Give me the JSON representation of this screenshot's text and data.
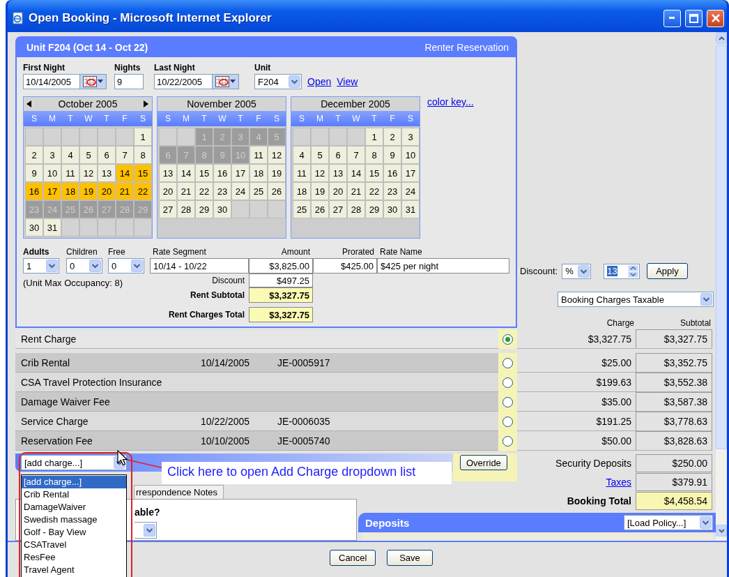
{
  "window": {
    "title": "Open Booking - Microsoft Internet Explorer"
  },
  "unit_panel": {
    "title": "Unit F204 (Oct 14 - Oct 22)",
    "subtitle": "Renter Reservation",
    "first_night": {
      "label": "First Night",
      "value": "10/14/2005"
    },
    "nights": {
      "label": "Nights",
      "value": "9"
    },
    "last_night": {
      "label": "Last Night",
      "value": "10/22/2005"
    },
    "unit": {
      "label": "Unit",
      "value": "F204"
    },
    "links": [
      "Open",
      "View"
    ],
    "color_key": "color key...",
    "calendars": [
      {
        "title": "October 2005",
        "prev_arrow": true,
        "next_arrow": true,
        "weekdays": [
          "S",
          "M",
          "T",
          "W",
          "T",
          "F",
          "S"
        ],
        "weeks": [
          [
            {
              "kind": "empty"
            },
            {
              "kind": "empty"
            },
            {
              "kind": "empty"
            },
            {
              "kind": "empty"
            },
            {
              "kind": "empty"
            },
            {
              "kind": "empty"
            },
            {
              "day": "1",
              "kind": "open"
            }
          ],
          [
            {
              "day": "2",
              "kind": "open"
            },
            {
              "day": "3",
              "kind": "open"
            },
            {
              "day": "4",
              "kind": "open"
            },
            {
              "day": "5",
              "kind": "open"
            },
            {
              "day": "6",
              "kind": "open"
            },
            {
              "day": "7",
              "kind": "open"
            },
            {
              "day": "8",
              "kind": "open"
            }
          ],
          [
            {
              "day": "9",
              "kind": "open"
            },
            {
              "day": "10",
              "kind": "open"
            },
            {
              "day": "11",
              "kind": "open"
            },
            {
              "day": "12",
              "kind": "open"
            },
            {
              "day": "13",
              "kind": "open"
            },
            {
              "day": "14",
              "kind": "booked"
            },
            {
              "day": "15",
              "kind": "booked"
            }
          ],
          [
            {
              "day": "16",
              "kind": "booked"
            },
            {
              "day": "17",
              "kind": "booked"
            },
            {
              "day": "18",
              "kind": "booked"
            },
            {
              "day": "19",
              "kind": "booked"
            },
            {
              "day": "20",
              "kind": "booked"
            },
            {
              "day": "21",
              "kind": "booked"
            },
            {
              "day": "22",
              "kind": "booked"
            }
          ],
          [
            {
              "day": "23",
              "kind": "blocked"
            },
            {
              "day": "24",
              "kind": "blocked"
            },
            {
              "day": "25",
              "kind": "blocked"
            },
            {
              "day": "26",
              "kind": "blocked"
            },
            {
              "day": "27",
              "kind": "blocked"
            },
            {
              "day": "28",
              "kind": "blocked"
            },
            {
              "day": "29",
              "kind": "blocked"
            }
          ],
          [
            {
              "day": "30",
              "kind": "open"
            },
            {
              "day": "31",
              "kind": "open"
            },
            {
              "kind": "empty"
            },
            {
              "kind": "empty"
            },
            {
              "kind": "empty"
            },
            {
              "kind": "empty"
            },
            {
              "kind": "empty"
            }
          ]
        ]
      },
      {
        "title": "November 2005",
        "prev_arrow": false,
        "next_arrow": false,
        "weekdays": [
          "S",
          "M",
          "T",
          "W",
          "T",
          "F",
          "S"
        ],
        "weeks": [
          [
            {
              "kind": "empty"
            },
            {
              "kind": "empty"
            },
            {
              "day": "1",
              "kind": "blocked"
            },
            {
              "day": "2",
              "kind": "blocked"
            },
            {
              "day": "3",
              "kind": "blocked"
            },
            {
              "day": "4",
              "kind": "blocked"
            },
            {
              "day": "5",
              "kind": "blocked"
            }
          ],
          [
            {
              "day": "6",
              "kind": "blocked"
            },
            {
              "day": "7",
              "kind": "blocked"
            },
            {
              "day": "8",
              "kind": "blocked"
            },
            {
              "day": "9",
              "kind": "blocked"
            },
            {
              "day": "10",
              "kind": "blocked"
            },
            {
              "day": "11",
              "kind": "open"
            },
            {
              "day": "12",
              "kind": "open"
            }
          ],
          [
            {
              "day": "13",
              "kind": "open"
            },
            {
              "day": "14",
              "kind": "open"
            },
            {
              "day": "15",
              "kind": "open"
            },
            {
              "day": "16",
              "kind": "open"
            },
            {
              "day": "17",
              "kind": "open"
            },
            {
              "day": "18",
              "kind": "open"
            },
            {
              "day": "19",
              "kind": "open"
            }
          ],
          [
            {
              "day": "20",
              "kind": "open"
            },
            {
              "day": "21",
              "kind": "open"
            },
            {
              "day": "22",
              "kind": "open"
            },
            {
              "day": "23",
              "kind": "open"
            },
            {
              "day": "24",
              "kind": "open"
            },
            {
              "day": "25",
              "kind": "open"
            },
            {
              "day": "26",
              "kind": "open"
            }
          ],
          [
            {
              "day": "27",
              "kind": "open"
            },
            {
              "day": "28",
              "kind": "open"
            },
            {
              "day": "29",
              "kind": "open"
            },
            {
              "day": "30",
              "kind": "open"
            },
            {
              "kind": "empty"
            },
            {
              "kind": "empty"
            },
            {
              "kind": "empty"
            }
          ]
        ]
      },
      {
        "title": "December 2005",
        "prev_arrow": false,
        "next_arrow": false,
        "weekdays": [
          "S",
          "M",
          "T",
          "W",
          "T",
          "F",
          "S"
        ],
        "weeks": [
          [
            {
              "kind": "empty"
            },
            {
              "kind": "empty"
            },
            {
              "kind": "empty"
            },
            {
              "kind": "empty"
            },
            {
              "day": "1",
              "kind": "open"
            },
            {
              "day": "2",
              "kind": "open"
            },
            {
              "day": "3",
              "kind": "open"
            }
          ],
          [
            {
              "day": "4",
              "kind": "open"
            },
            {
              "day": "5",
              "kind": "open"
            },
            {
              "day": "6",
              "kind": "open"
            },
            {
              "day": "7",
              "kind": "open"
            },
            {
              "day": "8",
              "kind": "open"
            },
            {
              "day": "9",
              "kind": "open"
            },
            {
              "day": "10",
              "kind": "open"
            }
          ],
          [
            {
              "day": "11",
              "kind": "open"
            },
            {
              "day": "12",
              "kind": "open"
            },
            {
              "day": "13",
              "kind": "open"
            },
            {
              "day": "14",
              "kind": "open"
            },
            {
              "day": "15",
              "kind": "open"
            },
            {
              "day": "16",
              "kind": "open"
            },
            {
              "day": "17",
              "kind": "open"
            }
          ],
          [
            {
              "day": "18",
              "kind": "open"
            },
            {
              "day": "19",
              "kind": "open"
            },
            {
              "day": "20",
              "kind": "open"
            },
            {
              "day": "21",
              "kind": "open"
            },
            {
              "day": "22",
              "kind": "open"
            },
            {
              "day": "23",
              "kind": "open"
            },
            {
              "day": "24",
              "kind": "open"
            }
          ],
          [
            {
              "day": "25",
              "kind": "open"
            },
            {
              "day": "26",
              "kind": "open"
            },
            {
              "day": "27",
              "kind": "open"
            },
            {
              "day": "28",
              "kind": "open"
            },
            {
              "day": "29",
              "kind": "open"
            },
            {
              "day": "30",
              "kind": "open"
            },
            {
              "day": "31",
              "kind": "open"
            }
          ]
        ]
      }
    ],
    "occupancy": {
      "fields": [
        {
          "label": "Adults",
          "value": "1",
          "bold": true
        },
        {
          "label": "Children",
          "value": "0",
          "bold": false
        },
        {
          "label": "Free",
          "value": "0",
          "bold": false
        }
      ],
      "note": "(Unit Max Occupancy: 8)"
    },
    "rate": {
      "headers": [
        "Rate Segment",
        "Amount",
        "Prorated",
        "Rate Name"
      ],
      "row": [
        "10/14 - 10/22",
        "$3,825.00",
        "$425.00",
        "$425 per night"
      ],
      "discount": {
        "label": "Discount",
        "value": "$497.25"
      },
      "subtotal": {
        "label": "Rent Subtotal",
        "value": "$3,327.75"
      },
      "total": {
        "label": "Rent Charges Total",
        "value": "$3,327.75"
      }
    }
  },
  "discount": {
    "label": "Discount:",
    "type": "%",
    "amount": "13",
    "button": "Apply"
  },
  "taxable": {
    "value": "Booking Charges Taxable"
  },
  "charges": {
    "columns": [
      "Charge",
      "Subtotal"
    ],
    "rows": [
      {
        "kind": "rent",
        "name": "Rent Charge",
        "selected": true,
        "charge": "$3,327.75",
        "subtotal": "$3,327.75"
      },
      {
        "kind": "item",
        "name": "Crib Rental",
        "date": "10/14/2005",
        "ref": "JE-0005917",
        "selected": false,
        "charge": "$25.00",
        "subtotal": "$3,352.75"
      },
      {
        "kind": "item",
        "name": "CSA Travel Protection Insurance",
        "selected": false,
        "charge": "$199.63",
        "subtotal": "$3,552.38"
      },
      {
        "kind": "item",
        "name": "Damage Waiver Fee",
        "selected": false,
        "charge": "$35.00",
        "subtotal": "$3,587.38"
      },
      {
        "kind": "item",
        "name": "Service Charge",
        "date": "10/22/2005",
        "ref": "JE-0006035",
        "selected": false,
        "charge": "$191.25",
        "subtotal": "$3,778.63"
      },
      {
        "kind": "item",
        "name": "Reservation Fee",
        "date": "10/10/2005",
        "ref": "JE-0005740",
        "selected": false,
        "charge": "$50.00",
        "subtotal": "$3,828.63"
      }
    ]
  },
  "add_charge": {
    "value": "[add charge...]",
    "options": [
      {
        "label": "[add charge...]",
        "selected": true
      },
      {
        "label": "Crib Rental",
        "selected": false
      },
      {
        "label": "DamageWaiver",
        "selected": false
      },
      {
        "label": "Swedish massage",
        "selected": false
      },
      {
        "label": "Golf - Bay View",
        "selected": false
      },
      {
        "label": "CSATravel",
        "selected": false
      },
      {
        "label": "ResFee",
        "selected": false
      },
      {
        "label": "Travel Agent",
        "selected": false
      }
    ]
  },
  "override": "Override",
  "totals": [
    {
      "kind": "plain",
      "label": "Security Deposits",
      "value": "$250.00"
    },
    {
      "kind": "link",
      "label": "Taxes",
      "value": "$379.91"
    },
    {
      "kind": "total",
      "label": "Booking Total",
      "value": "$4,458.54"
    }
  ],
  "notes_tab": "rrespondence Notes",
  "notes_panel": {
    "question": "able?"
  },
  "deposits": {
    "title": "Deposits",
    "policy": "[Load Policy...]"
  },
  "callout": "Click here to open Add Charge dropdown list",
  "buttons": [
    "Cancel",
    "Save"
  ]
}
